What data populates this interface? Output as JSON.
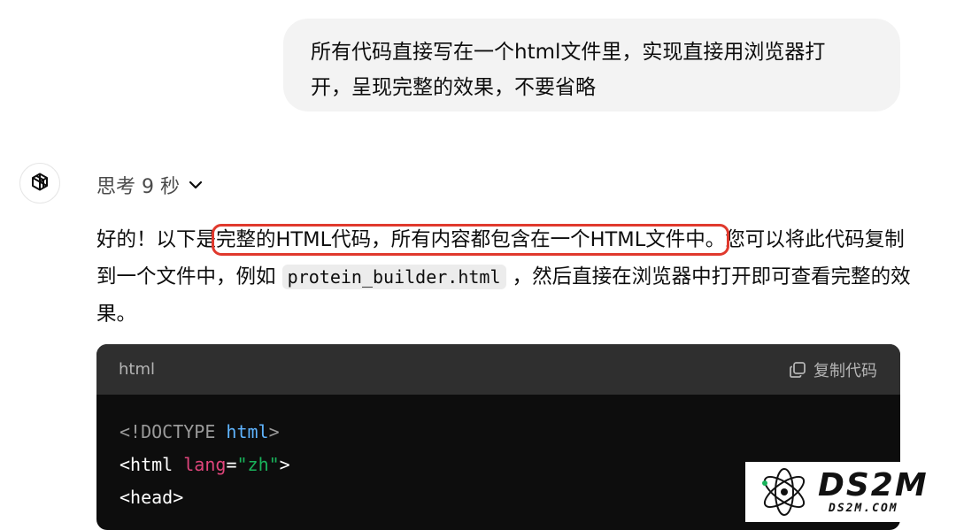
{
  "user_message": {
    "line1": "所有代码直接写在一个html文件里，实现直接用浏览器打",
    "line2": "开，呈现完整的效果，不要省略"
  },
  "assistant": {
    "avatar_icon": "openai-logo-icon",
    "thinking_label": "思考 9 秒",
    "thinking_icon": "chevron-down-icon",
    "answer_pre": "好的！以下是",
    "answer_highlight": "完整的HTML代码，所有内容都包含在一个HTML文件中。",
    "answer_mid": "您可以将此代码复制到一个文件中，例如",
    "filename_code": "protein_builder.html",
    "answer_post": "，然后直接在浏览器中打开即可查看完整的效果。",
    "highlight_color": "#e0392d"
  },
  "code_block": {
    "language": "html",
    "copy_label": "复制代码",
    "copy_icon": "copy-icon",
    "lines": [
      [
        "<!DOCTYPE ",
        "html",
        ">"
      ],
      [
        "<",
        "html",
        " ",
        "lang",
        "=",
        "\"zh\"",
        ">"
      ],
      [
        "<",
        "head",
        ">"
      ]
    ]
  },
  "watermark": {
    "text": "DS2M",
    "subtext": "DS2M.COM",
    "icon": "atom-logo-icon"
  }
}
